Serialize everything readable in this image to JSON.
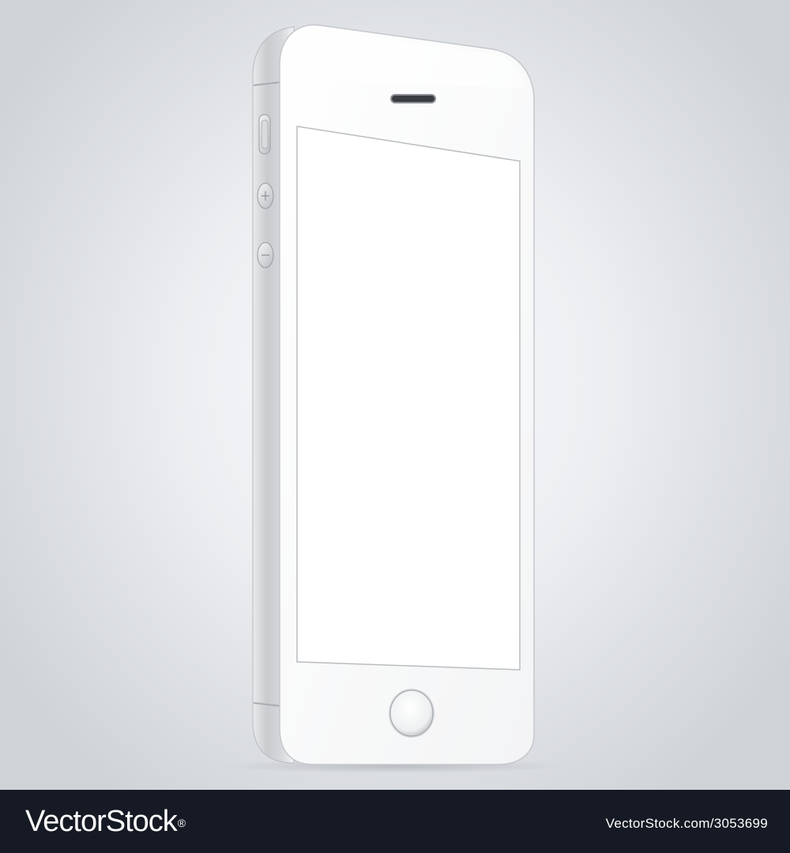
{
  "footer": {
    "brand": "VectorStock",
    "registered_mark": "®",
    "image_id": "VectorStock.com/3053699"
  },
  "colors": {
    "background": "#e6e8eb",
    "phone_body": "#fdfdfd",
    "phone_side": "#d4d6d9",
    "screen": "#ffffff",
    "footer": "#161a24"
  },
  "icons": [
    "speaker-icon",
    "home-button-icon",
    "mute-switch-icon",
    "volume-up-icon",
    "volume-down-icon"
  ]
}
